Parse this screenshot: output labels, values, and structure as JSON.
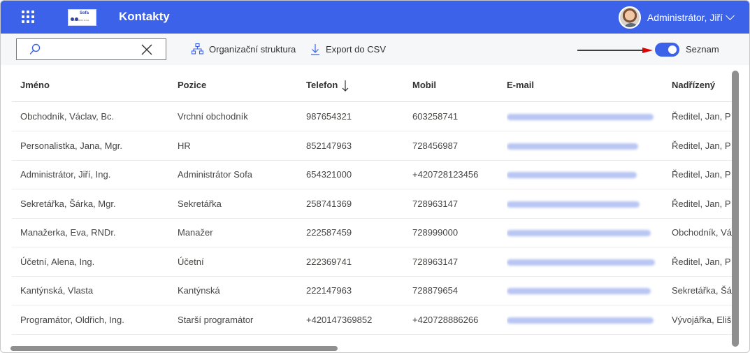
{
  "header": {
    "app_title": "Kontakty",
    "logo_text_top": "Sofa",
    "logo_text_bottom": "Solutions s.r.o.",
    "user_name": "Administrátor, Jiří",
    "background_color": "#3b62e8"
  },
  "toolbar": {
    "search_value": "",
    "org_structure_label": "Organizační struktura",
    "export_csv_label": "Export do CSV",
    "toggle_on": true,
    "toggle_label": "Seznam",
    "annotation_arrow_color": "#e00000"
  },
  "table": {
    "sorted_column": "Telefon",
    "sort_direction": "descending",
    "columns": [
      "Jméno",
      "Pozice",
      "Telefon",
      "Mobil",
      "E-mail",
      "Nadřízený"
    ],
    "rows": [
      {
        "name": "Obchodník, Václav, Bc.",
        "position": "Vrchní obchodník",
        "phone": "987654321",
        "mobile": "603258741",
        "email": "",
        "manager": "Ředitel, Jan, P"
      },
      {
        "name": "Personalistka, Jana, Mgr.",
        "position": "HR",
        "phone": "852147963",
        "mobile": "728456987",
        "email": "",
        "manager": "Ředitel, Jan, P"
      },
      {
        "name": "Administrátor, Jiří, Ing.",
        "position": "Administrátor Sofa",
        "phone": "654321000",
        "mobile": "+420728123456",
        "email": "",
        "manager": "Ředitel, Jan, P"
      },
      {
        "name": "Sekretářka, Šárka, Mgr.",
        "position": "Sekretářka",
        "phone": "258741369",
        "mobile": "728963147",
        "email": "",
        "manager": "Ředitel, Jan, P"
      },
      {
        "name": "Manažerka, Eva, RNDr.",
        "position": "Manažer",
        "phone": "222587459",
        "mobile": "728999000",
        "email": "",
        "manager": "Obchodník, Vá"
      },
      {
        "name": "Účetní, Alena, Ing.",
        "position": "Účetní",
        "phone": "222369741",
        "mobile": "728963147",
        "email": "",
        "manager": "Ředitel, Jan, P"
      },
      {
        "name": "Kantýnská, Vlasta",
        "position": "Kantýnská",
        "phone": "222147963",
        "mobile": "728879654",
        "email": "",
        "manager": "Sekretářka, Šá"
      },
      {
        "name": "Programátor, Oldřich, Ing.",
        "position": "Starší programátor",
        "phone": "+420147369852",
        "mobile": "+420728886266",
        "email": "",
        "manager": "Vývojářka, Eliš"
      }
    ]
  }
}
